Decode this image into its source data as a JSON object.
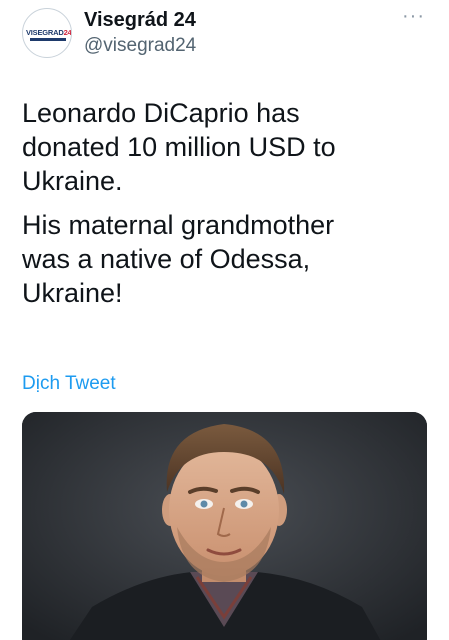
{
  "account": {
    "display_name": "Visegrád 24",
    "handle": "@visegrad24",
    "avatar_text_a": "VISEGRAD",
    "avatar_text_b": "24"
  },
  "menu": {
    "more_label": "···"
  },
  "tweet": {
    "paragraph_1": "Leonardo DiCaprio has\ndonated 10 million USD to\nUkraine.",
    "paragraph_2": "His maternal grandmother\nwas a native of Odessa,\nUkraine!"
  },
  "translate": {
    "label": "Dịch Tweet"
  },
  "media": {
    "kind": "photo",
    "subject": "man-portrait"
  },
  "colors": {
    "text": "#0f1419",
    "muted": "#536471",
    "link": "#1d9bf0",
    "photo_background": "#2a2d31"
  }
}
